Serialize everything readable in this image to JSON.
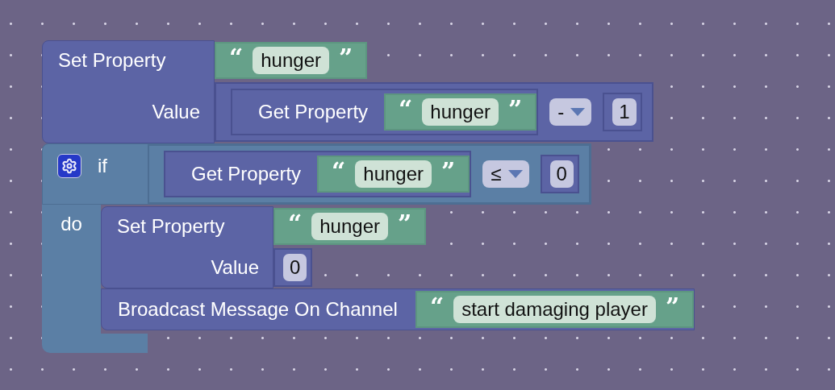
{
  "workspace": {
    "stack": [
      {
        "kind": "set_property",
        "label": "Set Property",
        "value_label": "Value",
        "property": {
          "kind": "text",
          "open_quote": "“",
          "text": "hunger",
          "close_quote": "”"
        },
        "value": {
          "kind": "math",
          "left": {
            "kind": "get_property",
            "label": "Get Property",
            "property": {
              "kind": "text",
              "open_quote": "“",
              "text": "hunger",
              "close_quote": "”"
            }
          },
          "operator": "-",
          "right": {
            "kind": "number",
            "text": "1"
          }
        }
      },
      {
        "kind": "if",
        "label": "if",
        "do_label": "do",
        "condition": {
          "kind": "compare",
          "left": {
            "kind": "get_property",
            "label": "Get Property",
            "property": {
              "kind": "text",
              "open_quote": "“",
              "text": "hunger",
              "close_quote": "”"
            }
          },
          "operator": "≤",
          "right": {
            "kind": "number",
            "text": "0"
          }
        },
        "do": [
          {
            "kind": "set_property",
            "label": "Set Property",
            "value_label": "Value",
            "property": {
              "kind": "text",
              "open_quote": "“",
              "text": "hunger",
              "close_quote": "”"
            },
            "value": {
              "kind": "number",
              "text": "0"
            }
          },
          {
            "kind": "broadcast",
            "label": "Broadcast Message On Channel",
            "message": {
              "kind": "text",
              "open_quote": "“",
              "text": "start damaging player",
              "close_quote": "”"
            }
          }
        ]
      }
    ]
  }
}
